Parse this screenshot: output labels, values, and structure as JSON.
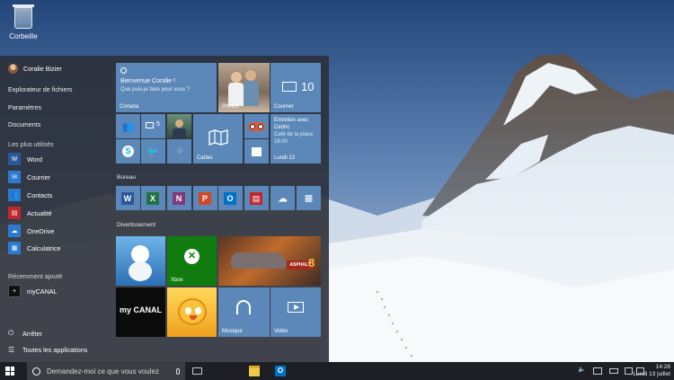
{
  "desktop": {
    "recycle_bin_label": "Corbeille"
  },
  "start_menu": {
    "user_name": "Coralie Bizier",
    "links": [
      "Explorateur de fichiers",
      "Paramètres",
      "Documents"
    ],
    "most_used_header": "Les plus utilisés",
    "apps": [
      {
        "label": "Word",
        "icon": "word-icon",
        "color": "#2b579a"
      },
      {
        "label": "Courrier",
        "icon": "mail-icon",
        "color": "#2d7bd1"
      },
      {
        "label": "Contacts",
        "icon": "people-icon",
        "color": "#2d7bd1"
      },
      {
        "label": "Actualité",
        "icon": "news-icon",
        "color": "#c1272d"
      },
      {
        "label": "OneDrive",
        "icon": "onedrive-icon",
        "color": "#2d7bd1"
      },
      {
        "label": "Calculatrice",
        "icon": "calculator-icon",
        "color": "#2d7bd1"
      }
    ],
    "recent_header": "Récemment ajouté",
    "recent_apps": [
      {
        "label": "myCANAL",
        "icon": "plus-icon",
        "color": "#111111"
      }
    ],
    "power_label": "Arrêter",
    "all_apps_label": "Toutes les applications",
    "tiles": {
      "cortana": {
        "title": "Bienvenue Coralie !",
        "subtitle": "Que puis-je faire pour vous ?",
        "label": "Cortana",
        "color": "#5b88b8"
      },
      "photos": {
        "label": "Photos"
      },
      "mail": {
        "label": "Courrier",
        "count": "10",
        "color": "#5b88b8"
      },
      "people": {
        "color": "#5b88b8"
      },
      "messaging": {
        "count": "5",
        "color": "#5b88b8"
      },
      "maps": {
        "label": "Cartes",
        "color": "#5b88b8"
      },
      "tripadvisor": {
        "color": "#5b88b8"
      },
      "calendar": {
        "event": "Entretien avec Cédric",
        "place": "Café de la place",
        "time": "16:00",
        "date": "Lundi 13",
        "color": "#5b88b8"
      },
      "skype": {
        "color": "#5b88b8"
      },
      "twitter": {
        "color": "#5b88b8"
      },
      "dots": {
        "color": "#5b88b8"
      },
      "store": {
        "color": "#5b88b8"
      }
    },
    "bureau_header": "Bureau",
    "bureau_apps": [
      {
        "icon": "word-icon",
        "letter": "W",
        "color": "#2b579a"
      },
      {
        "icon": "excel-icon",
        "letter": "X",
        "color": "#217346"
      },
      {
        "icon": "onenote-icon",
        "letter": "N",
        "color": "#80397b"
      },
      {
        "icon": "powerpoint-icon",
        "letter": "P",
        "color": "#d24726"
      },
      {
        "icon": "outlook-icon",
        "letter": "O",
        "color": "#0072c6"
      },
      {
        "icon": "news-icon",
        "letter": "▤",
        "color": "#c1272d"
      },
      {
        "icon": "onedrive-icon",
        "letter": "☁",
        "color": "#0a6ed1"
      },
      {
        "icon": "calculator-icon",
        "letter": "▦",
        "color": "#3c6ea8"
      }
    ],
    "entertainment_header": "Divertissement",
    "entertainment_tiles": {
      "xbox": {
        "label": "Xbox",
        "color": "#107c10"
      },
      "asphalt": {
        "badge": "8"
      },
      "mycanal": {
        "text": "my CANAL"
      },
      "music": {
        "label": "Musique",
        "color": "#5b88b8"
      },
      "video": {
        "label": "Vidéo",
        "color": "#5b88b8"
      }
    }
  },
  "taskbar": {
    "search_placeholder": "Demandez-moi ce que vous voulez",
    "time": "14:28",
    "date": "Lundi 13 juillet"
  }
}
